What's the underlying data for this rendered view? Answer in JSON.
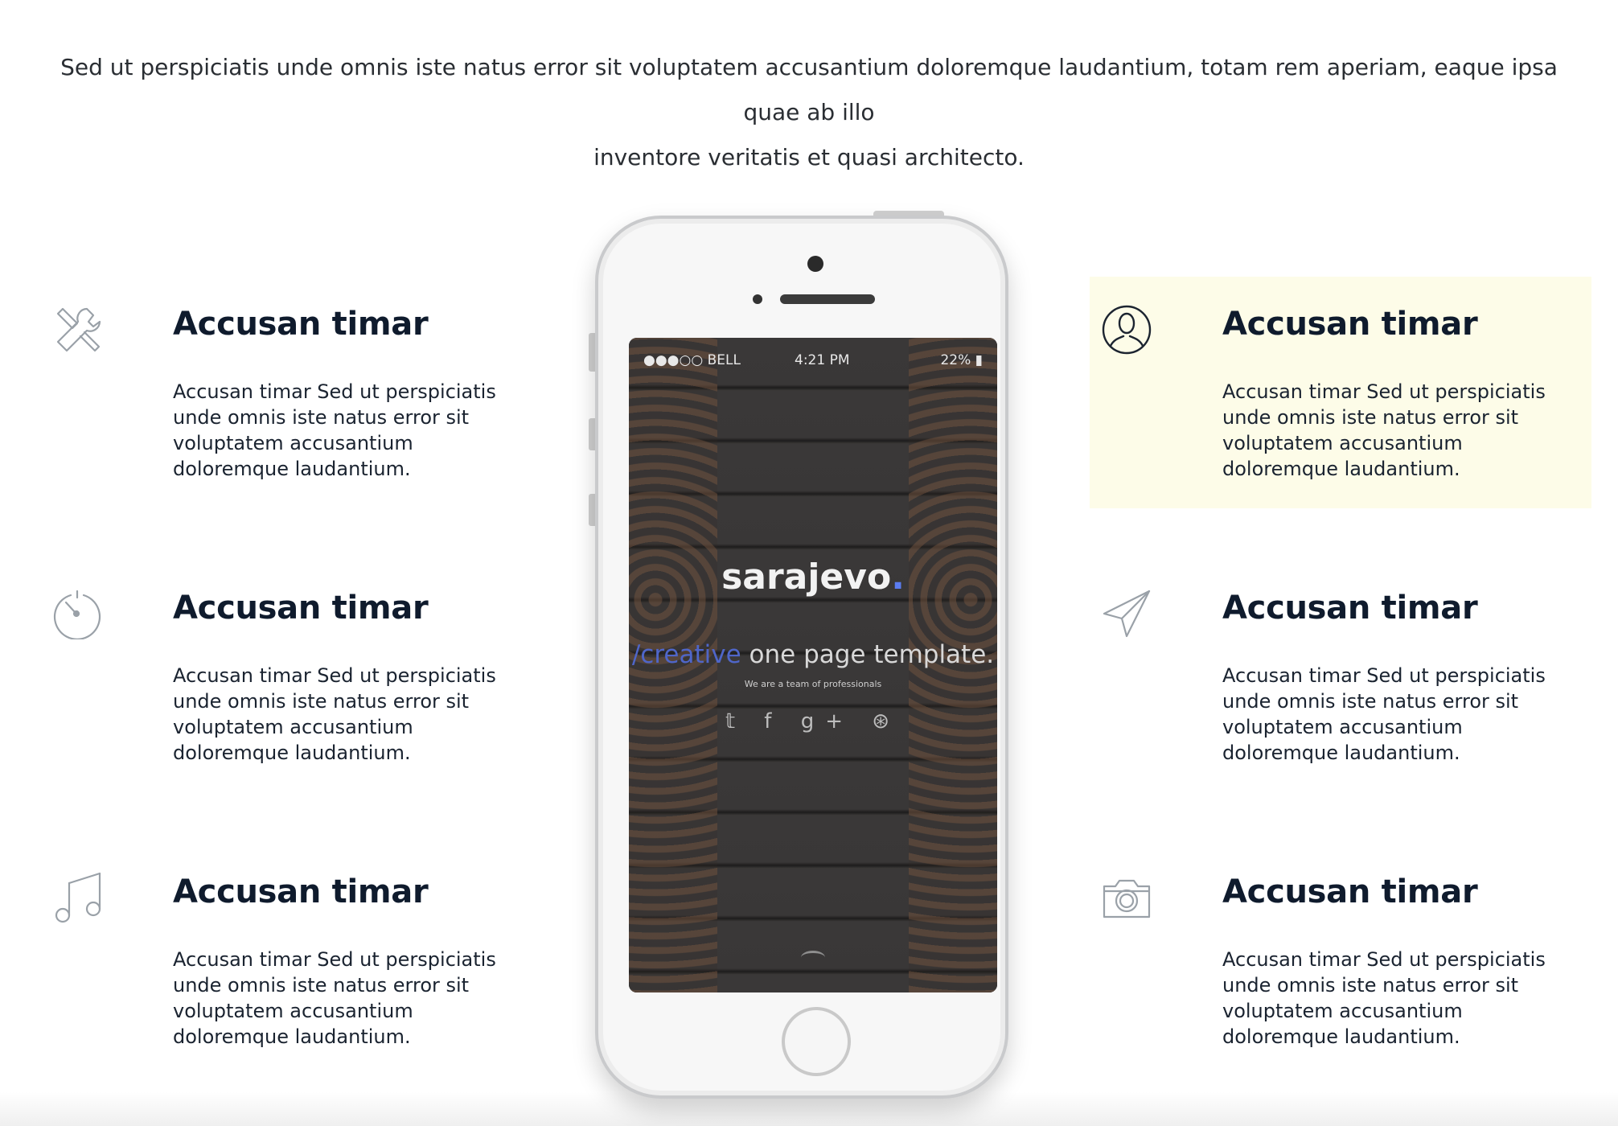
{
  "intro": {
    "line1": "Sed ut perspiciatis unde omnis iste natus error sit voluptatem accusantium doloremque laudantium, totam rem aperiam, eaque ipsa quae ab illo",
    "line2": "inventore veritatis et quasi architecto."
  },
  "features_left": [
    {
      "icon": "tools-icon",
      "title": "Accusan timar",
      "text": "Accusan timar Sed ut perspiciatis unde omnis iste natus error sit voluptatem accusantium doloremque laudantium."
    },
    {
      "icon": "timer-icon",
      "title": "Accusan timar",
      "text": "Accusan timar Sed ut perspiciatis unde omnis iste natus error sit voluptatem accusantium doloremque laudantium."
    },
    {
      "icon": "music-icon",
      "title": "Accusan timar",
      "text": "Accusan timar Sed ut perspiciatis unde omnis iste natus error sit voluptatem accusantium doloremque laudantium."
    }
  ],
  "features_right": [
    {
      "icon": "user-icon",
      "title": "Accusan timar",
      "text": "Accusan timar Sed ut perspiciatis unde omnis iste natus error sit voluptatem accusantium doloremque laudantium.",
      "highlighted": true
    },
    {
      "icon": "paper-plane-icon",
      "title": "Accusan timar",
      "text": "Accusan timar Sed ut perspiciatis unde omnis iste natus error sit voluptatem accusantium doloremque laudantium."
    },
    {
      "icon": "camera-icon",
      "title": "Accusan timar",
      "text": "Accusan timar Sed ut perspiciatis unde omnis iste natus error sit voluptatem accusantium doloremque laudantium."
    }
  ],
  "phone": {
    "status": {
      "carrier": "●●●○○ BELL",
      "time": "4:21 PM",
      "battery": "22%"
    },
    "brand": "sarajevo",
    "brand_dot": ".",
    "tagline_accent": "/creative",
    "tagline_rest": " one page template.",
    "subtag": "We are a team of professionals",
    "social": "𝕥 f g+ ⊛"
  },
  "colors": {
    "highlight_bg": "#fdfce8",
    "heading": "#0f1b2d",
    "icon_gray": "#9aa1a8",
    "brand_accent": "#5b7cf0"
  }
}
